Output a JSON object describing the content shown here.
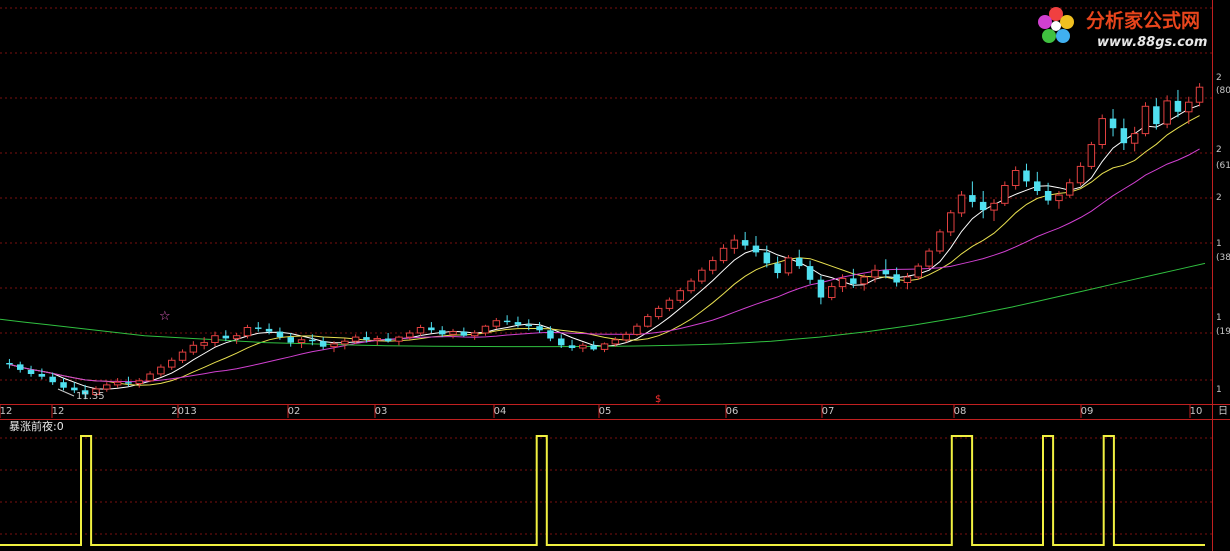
{
  "chart_data": [
    {
      "type": "candlestick",
      "x_ticks": [
        "12",
        "12",
        "2013",
        "02",
        "03",
        "04",
        "05",
        "06",
        "07",
        "08",
        "09",
        "10"
      ],
      "low_annotation": "11.35",
      "axis_corner_label": "日",
      "right_axis_fragments": [
        "2",
        "(80",
        "2",
        "(61",
        "2",
        "1",
        "(38",
        "1",
        "(19",
        "1"
      ],
      "ohlc": [
        [
          14.0,
          14.3,
          13.6,
          13.9
        ],
        [
          13.9,
          14.1,
          13.3,
          13.5
        ],
        [
          13.5,
          13.8,
          13.0,
          13.2
        ],
        [
          13.2,
          13.6,
          12.8,
          13.0
        ],
        [
          13.0,
          13.3,
          12.4,
          12.6
        ],
        [
          12.6,
          12.9,
          12.0,
          12.2
        ],
        [
          12.2,
          12.6,
          11.8,
          12.0
        ],
        [
          12.0,
          12.4,
          11.35,
          11.7
        ],
        [
          11.7,
          12.3,
          11.6,
          12.1
        ],
        [
          12.1,
          12.6,
          11.9,
          12.4
        ],
        [
          12.4,
          12.9,
          12.2,
          12.6
        ],
        [
          12.6,
          13.0,
          12.3,
          12.5
        ],
        [
          12.5,
          12.9,
          12.2,
          12.7
        ],
        [
          12.7,
          13.4,
          12.6,
          13.2
        ],
        [
          13.2,
          13.9,
          13.0,
          13.7
        ],
        [
          13.7,
          14.4,
          13.5,
          14.2
        ],
        [
          14.2,
          15.0,
          14.0,
          14.8
        ],
        [
          14.8,
          15.6,
          14.6,
          15.3
        ],
        [
          15.3,
          15.9,
          15.0,
          15.5
        ],
        [
          15.5,
          16.3,
          15.2,
          16.0
        ],
        [
          16.0,
          16.4,
          15.6,
          15.8
        ],
        [
          15.8,
          16.2,
          15.4,
          16.0
        ],
        [
          16.0,
          16.8,
          15.8,
          16.6
        ],
        [
          16.6,
          17.0,
          16.3,
          16.5
        ],
        [
          16.5,
          16.9,
          16.1,
          16.3
        ],
        [
          16.3,
          16.6,
          15.7,
          15.9
        ],
        [
          15.9,
          16.2,
          15.2,
          15.5
        ],
        [
          15.5,
          15.9,
          15.1,
          15.7
        ],
        [
          15.7,
          16.1,
          15.3,
          15.6
        ],
        [
          15.6,
          15.9,
          15.0,
          15.2
        ],
        [
          15.2,
          15.6,
          14.8,
          15.4
        ],
        [
          15.4,
          15.8,
          15.0,
          15.6
        ],
        [
          15.6,
          16.1,
          15.4,
          15.9
        ],
        [
          15.9,
          16.3,
          15.5,
          15.7
        ],
        [
          15.7,
          16.0,
          15.3,
          15.8
        ],
        [
          15.8,
          16.2,
          15.5,
          15.6
        ],
        [
          15.6,
          16.0,
          15.3,
          15.9
        ],
        [
          15.9,
          16.4,
          15.7,
          16.2
        ],
        [
          16.2,
          16.8,
          16.0,
          16.6
        ],
        [
          16.6,
          17.0,
          16.2,
          16.4
        ],
        [
          16.4,
          16.7,
          15.9,
          16.1
        ],
        [
          16.1,
          16.5,
          15.8,
          16.3
        ],
        [
          16.3,
          16.6,
          15.9,
          16.0
        ],
        [
          16.0,
          16.4,
          15.7,
          16.2
        ],
        [
          16.2,
          16.8,
          16.0,
          16.7
        ],
        [
          16.7,
          17.3,
          16.5,
          17.1
        ],
        [
          17.1,
          17.5,
          16.8,
          17.0
        ],
        [
          17.0,
          17.4,
          16.6,
          16.8
        ],
        [
          16.8,
          17.2,
          16.4,
          16.7
        ],
        [
          16.7,
          17.0,
          16.2,
          16.4
        ],
        [
          16.4,
          16.7,
          15.6,
          15.8
        ],
        [
          15.8,
          16.1,
          15.1,
          15.3
        ],
        [
          15.3,
          15.7,
          14.9,
          15.1
        ],
        [
          15.1,
          15.5,
          14.8,
          15.3
        ],
        [
          15.3,
          15.6,
          14.9,
          15.0
        ],
        [
          15.0,
          15.5,
          14.8,
          15.4
        ],
        [
          15.4,
          15.9,
          15.2,
          15.7
        ],
        [
          15.7,
          16.3,
          15.5,
          16.1
        ],
        [
          16.1,
          16.9,
          16.0,
          16.7
        ],
        [
          16.7,
          17.6,
          16.6,
          17.4
        ],
        [
          17.4,
          18.2,
          17.2,
          18.0
        ],
        [
          18.0,
          18.8,
          17.8,
          18.6
        ],
        [
          18.6,
          19.5,
          18.4,
          19.3
        ],
        [
          19.3,
          20.2,
          19.1,
          20.0
        ],
        [
          20.0,
          21.0,
          19.8,
          20.8
        ],
        [
          20.8,
          21.8,
          20.5,
          21.5
        ],
        [
          21.5,
          22.7,
          21.3,
          22.4
        ],
        [
          22.4,
          23.4,
          22.0,
          23.0
        ],
        [
          23.0,
          23.6,
          22.3,
          22.6
        ],
        [
          22.6,
          23.3,
          21.8,
          22.1
        ],
        [
          22.1,
          22.6,
          21.0,
          21.3
        ],
        [
          21.3,
          21.8,
          20.2,
          20.6
        ],
        [
          20.6,
          21.9,
          20.4,
          21.7
        ],
        [
          21.7,
          22.3,
          20.9,
          21.1
        ],
        [
          21.1,
          21.5,
          19.8,
          20.1
        ],
        [
          20.1,
          20.4,
          18.3,
          18.8
        ],
        [
          18.8,
          19.9,
          18.6,
          19.6
        ],
        [
          19.6,
          20.5,
          19.2,
          20.2
        ],
        [
          20.2,
          20.9,
          19.5,
          19.8
        ],
        [
          19.8,
          20.5,
          19.3,
          20.3
        ],
        [
          20.3,
          21.2,
          19.9,
          20.8
        ],
        [
          20.8,
          21.6,
          20.2,
          20.5
        ],
        [
          20.5,
          21.0,
          19.6,
          19.9
        ],
        [
          19.9,
          20.6,
          19.4,
          20.3
        ],
        [
          20.3,
          21.3,
          20.1,
          21.1
        ],
        [
          21.1,
          22.4,
          20.9,
          22.2
        ],
        [
          22.2,
          23.8,
          22.0,
          23.6
        ],
        [
          23.6,
          25.2,
          23.3,
          25.0
        ],
        [
          25.0,
          26.6,
          24.7,
          26.3
        ],
        [
          26.3,
          27.3,
          25.4,
          25.8
        ],
        [
          25.8,
          26.6,
          24.6,
          25.2
        ],
        [
          25.2,
          26.0,
          24.4,
          25.7
        ],
        [
          25.7,
          27.3,
          25.5,
          27.0
        ],
        [
          27.0,
          28.4,
          26.7,
          28.1
        ],
        [
          28.1,
          28.6,
          26.9,
          27.3
        ],
        [
          27.3,
          28.0,
          26.3,
          26.6
        ],
        [
          26.6,
          27.2,
          25.6,
          25.9
        ],
        [
          25.9,
          26.6,
          25.3,
          26.3
        ],
        [
          26.3,
          27.5,
          26.1,
          27.2
        ],
        [
          27.2,
          28.7,
          27.0,
          28.4
        ],
        [
          28.4,
          30.2,
          28.2,
          30.0
        ],
        [
          30.0,
          32.2,
          29.7,
          31.9
        ],
        [
          31.9,
          32.6,
          30.6,
          31.2
        ],
        [
          31.2,
          31.9,
          29.6,
          30.1
        ],
        [
          30.1,
          31.3,
          29.5,
          30.8
        ],
        [
          30.8,
          33.1,
          30.6,
          32.8
        ],
        [
          32.8,
          33.4,
          31.1,
          31.5
        ],
        [
          31.5,
          33.6,
          31.2,
          33.2
        ],
        [
          33.2,
          34.0,
          32.0,
          32.4
        ],
        [
          32.4,
          33.5,
          31.5,
          33.1
        ],
        [
          33.1,
          34.5,
          32.8,
          34.2
        ]
      ],
      "ma_series": [
        {
          "color": "#ffffff",
          "period": 5
        },
        {
          "color": "#e8e050",
          "period": 10
        },
        {
          "color": "#d040d0",
          "period": 20
        },
        {
          "color": "#30c040",
          "period": 250
        }
      ],
      "long_ma": [
        17.2,
        17.0,
        16.8,
        16.6,
        16.4,
        16.2,
        16.0,
        15.9,
        15.8,
        15.7,
        15.6,
        15.5,
        15.45,
        15.4,
        15.35,
        15.3,
        15.27,
        15.25,
        15.23,
        15.22,
        15.21,
        15.2,
        15.2,
        15.2,
        15.21,
        15.22,
        15.24,
        15.26,
        15.3,
        15.35,
        15.4,
        15.5,
        15.6,
        15.75,
        15.9,
        16.1,
        16.3,
        16.55,
        16.8,
        17.1,
        17.4,
        17.75,
        18.1,
        18.5,
        18.9,
        19.3,
        19.7,
        20.1,
        20.5,
        20.9,
        21.3
      ]
    },
    {
      "type": "line",
      "indicator_label": "暴涨前夜:0",
      "values": [
        0,
        0,
        0,
        0,
        0,
        0,
        0,
        0,
        1,
        0,
        0,
        0,
        0,
        0,
        0,
        0,
        0,
        0,
        0,
        0,
        0,
        0,
        0,
        0,
        0,
        0,
        0,
        0,
        0,
        0,
        0,
        0,
        0,
        0,
        0,
        0,
        0,
        0,
        0,
        0,
        0,
        0,
        0,
        0,
        0,
        0,
        0,
        0,
        0,
        0,
        0,
        0,
        0,
        1,
        0,
        0,
        0,
        0,
        0,
        0,
        0,
        0,
        0,
        0,
        0,
        0,
        0,
        0,
        0,
        0,
        0,
        0,
        0,
        0,
        0,
        0,
        0,
        0,
        0,
        0,
        0,
        0,
        0,
        0,
        0,
        0,
        0,
        0,
        0,
        0,
        0,
        0,
        0,
        0,
        1,
        1,
        0,
        0,
        0,
        0,
        0,
        0,
        0,
        1,
        0,
        0,
        0,
        0,
        0,
        1,
        0,
        0,
        0,
        0,
        0,
        0,
        0,
        0,
        0
      ],
      "ylim": [
        0,
        1
      ]
    }
  ],
  "logo": {
    "name": "分析家公式网",
    "url": "www.88gs.com"
  }
}
